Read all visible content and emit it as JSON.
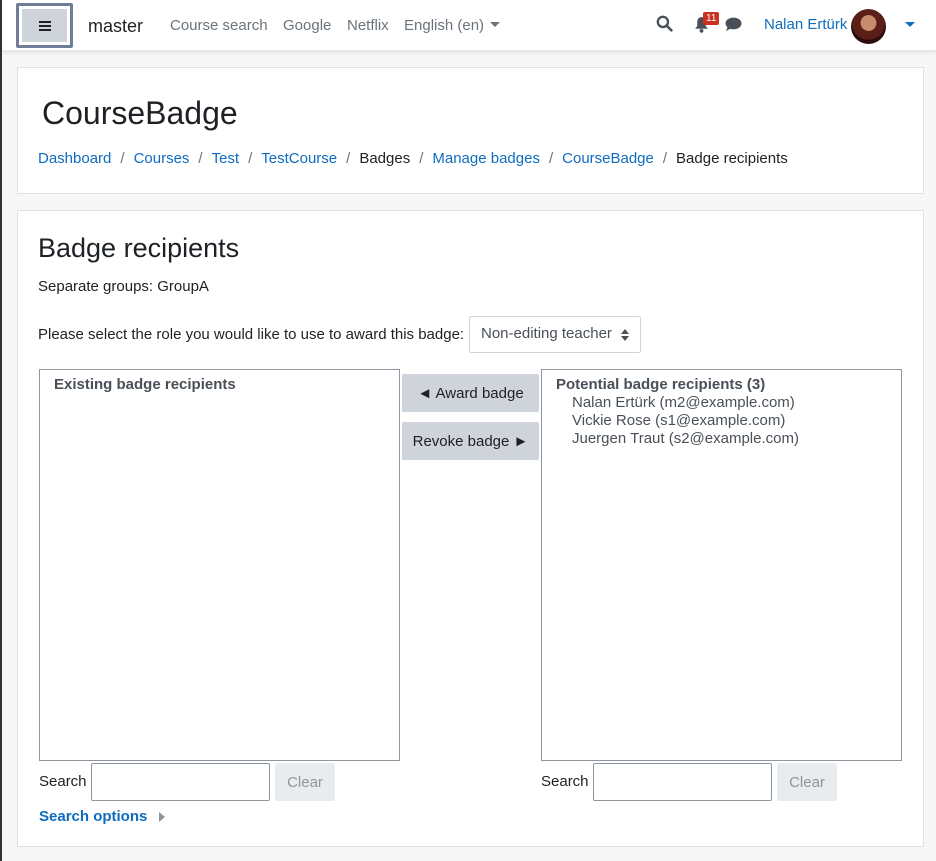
{
  "navbar": {
    "brand": "master",
    "links": [
      "Course search",
      "Google",
      "Netflix"
    ],
    "language": "English (en)",
    "notification_count": "11",
    "user_name": "Nalan Ertürk",
    "icons": [
      "menu-icon",
      "search-icon",
      "bell-icon",
      "chat-icon"
    ]
  },
  "header": {
    "title": "CourseBadge",
    "breadcrumb": [
      "Dashboard",
      "Courses",
      "Test",
      "TestCourse",
      "Badges",
      "Manage badges",
      "CourseBadge",
      "Badge recipients"
    ]
  },
  "main": {
    "title": "Badge recipients",
    "groups_text": "Separate groups: GroupA",
    "role_label": "Please select the role you would like to use to award this badge:",
    "role_selected": "Non-editing teacher",
    "existing": {
      "heading": "Existing badge recipients",
      "items": []
    },
    "potential": {
      "heading": "Potential badge recipients (3)",
      "items": [
        "Nalan Ertürk (m2@example.com)",
        "Vickie Rose (s1@example.com)",
        "Juergen Traut (s2@example.com)"
      ]
    },
    "award_label": "◄ Award badge",
    "revoke_label": "Revoke badge ►",
    "search_label": "Search",
    "clear_label": "Clear",
    "search_options": "Search options"
  },
  "colors": {
    "link": "#0f6cbf",
    "notification_badge": "#ca3120",
    "button_secondary": "#ced4da"
  }
}
